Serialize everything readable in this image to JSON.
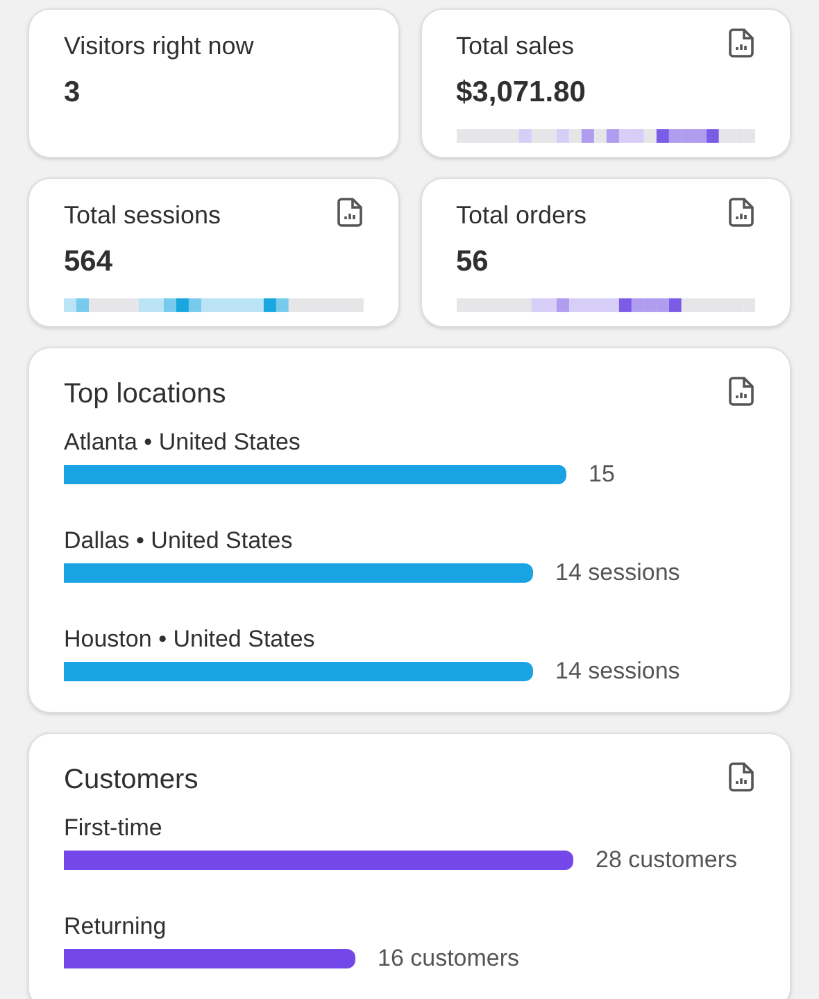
{
  "stats": [
    {
      "label": "Visitors right now",
      "value": "3",
      "report_icon": false
    },
    {
      "label": "Total sales",
      "value": "$3,071.80",
      "report_icon": true,
      "color": "#7c5ce6"
    },
    {
      "label": "Total sessions",
      "value": "564",
      "report_icon": true,
      "color": "#1aa6e0"
    },
    {
      "label": "Total orders",
      "value": "56",
      "report_icon": true,
      "color": "#7c5ce6"
    }
  ],
  "top_locations": {
    "title": "Top locations",
    "color": "#1aa3e2",
    "rows": [
      {
        "city": "Atlanta",
        "country": "United States",
        "separator": "•",
        "reading": "15"
      },
      {
        "city": "Dallas",
        "country": "United States",
        "separator": "•",
        "reading": "14 sessions"
      },
      {
        "city": "Houston",
        "country": "United States",
        "separator": "•",
        "reading": "14 sessions"
      }
    ]
  },
  "customers": {
    "title": "Customers",
    "color": "#7448e8",
    "rows": [
      {
        "label": "First-time",
        "reading": "28 customers"
      },
      {
        "label": "Returning",
        "reading": "16 customers"
      }
    ]
  }
}
